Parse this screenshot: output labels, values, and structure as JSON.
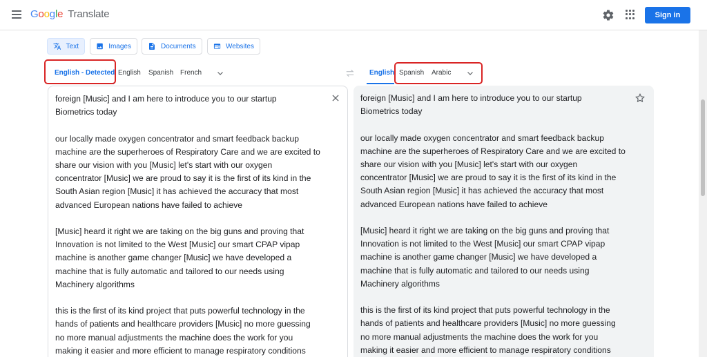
{
  "header": {
    "logo_letters": [
      "G",
      "o",
      "o",
      "g",
      "l",
      "e"
    ],
    "product": "Translate",
    "signin_label": "Sign in"
  },
  "modes": [
    {
      "label": "Text",
      "icon": "translate-icon",
      "active": true
    },
    {
      "label": "Images",
      "icon": "image-icon"
    },
    {
      "label": "Documents",
      "icon": "document-icon"
    },
    {
      "label": "Websites",
      "icon": "website-icon"
    }
  ],
  "source_langs": [
    "English - Detected",
    "English",
    "Spanish",
    "French"
  ],
  "target_langs": [
    "English",
    "Spanish",
    "Arabic"
  ],
  "source_text": "foreign [Music] and I am here to introduce you to our startup\nBiometrics today\n\nour locally made oxygen concentrator and smart feedback backup\nmachine are the superheroes of Respiratory Care and we are excited to\nshare our vision with you [Music] let's start with our oxygen\nconcentrator [Music] we are proud to say it is the first of its kind in the\nSouth Asian region [Music] it has achieved the accuracy that most\nadvanced European nations have failed to achieve\n\n[Music] heard it right we are taking on the big guns and proving that\nInnovation is not limited to the West [Music] our smart CPAP vipap\nmachine is another game changer [Music] we have developed a\nmachine that is fully automatic and tailored to our needs using\nMachinery algorithms\n\nthis is the first of its kind project that puts powerful technology in the\nhands of patients and healthcare providers [Music] no more guessing\nno more manual adjustments the machine does the work for you\nmaking it easier and more efficient to manage respiratory conditions",
  "target_text": "foreign [Music] and I am here to introduce you to our startup\nBiometrics today\n\nour locally made oxygen concentrator and smart feedback backup\nmachine are the superheroes of Respiratory Care and we are excited to\nshare our vision with you [Music] let's start with our oxygen\nconcentrator [Music] we are proud to say it is the first of its kind in the\nSouth Asian region [Music] it has achieved the accuracy that most\nadvanced European nations have failed to achieve\n\n[Music] heard it right we are taking on the big guns and proving that\nInnovation is not limited to the West [Music] our smart CPAP vipap\nmachine is another game changer [Music] we have developed a\nmachine that is fully automatic and tailored to our needs using\nMachinery algorithms\n\nthis is the first of its kind project that puts powerful technology in the\nhands of patients and healthcare providers [Music] no more guessing\nno more manual adjustments the machine does the work for you\nmaking it easier and more efficient to manage respiratory conditions",
  "colors": {
    "accent": "#1a73e8",
    "highlight_box": "#d92424"
  }
}
